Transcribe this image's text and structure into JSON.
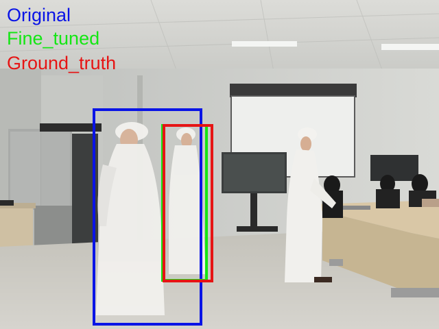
{
  "legend": [
    {
      "label": "Original",
      "color": "#0a14e6"
    },
    {
      "label": "Fine_tuned",
      "color": "#14e614"
    },
    {
      "label": "Ground_truth",
      "color": "#e61414"
    }
  ],
  "detections": [
    {
      "kind": "Original",
      "color": "#0a14e6"
    },
    {
      "kind": "Fine_tuned",
      "color": "#14e614"
    },
    {
      "kind": "Ground_truth",
      "color": "#e61414"
    }
  ]
}
